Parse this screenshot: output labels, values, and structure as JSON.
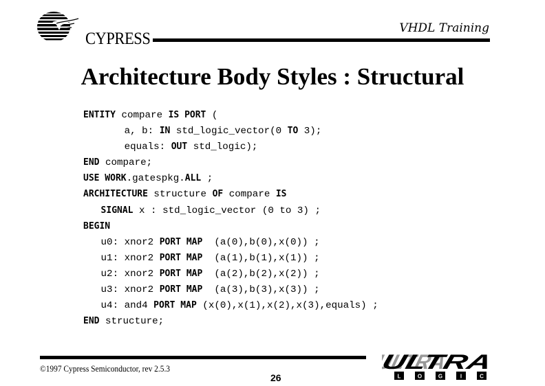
{
  "header": {
    "logo_text": "CYPRESS",
    "course_title": "VHDL Training"
  },
  "slide": {
    "title": "Architecture Body Styles : Structural",
    "code_lines": [
      [
        {
          "t": "ENTITY",
          "k": true
        },
        {
          "t": " compare "
        },
        {
          "t": "IS PORT",
          "k": true
        },
        {
          "t": " ("
        }
      ],
      [
        {
          "t": "       a, b: "
        },
        {
          "t": "IN",
          "k": true
        },
        {
          "t": " std_logic_vector(0 "
        },
        {
          "t": "TO",
          "k": true
        },
        {
          "t": " 3);"
        }
      ],
      [
        {
          "t": "       equals: "
        },
        {
          "t": "OUT",
          "k": true
        },
        {
          "t": " std_logic);"
        }
      ],
      [
        {
          "t": "END",
          "k": true
        },
        {
          "t": " compare;"
        }
      ],
      [
        {
          "t": "USE WORK",
          "k": true
        },
        {
          "t": ".gatespkg."
        },
        {
          "t": "ALL",
          "k": true
        },
        {
          "t": " ;"
        }
      ],
      [
        {
          "t": "ARCHITECTURE",
          "k": true
        },
        {
          "t": " structure "
        },
        {
          "t": "OF",
          "k": true
        },
        {
          "t": " compare "
        },
        {
          "t": "IS",
          "k": true
        }
      ],
      [
        {
          "t": "   "
        },
        {
          "t": "SIGNAL",
          "k": true
        },
        {
          "t": " x : std_logic_vector (0 to 3) ;"
        }
      ],
      [
        {
          "t": "BEGIN",
          "k": true
        }
      ],
      [
        {
          "t": "   u0: xnor2 "
        },
        {
          "t": "PORT MAP",
          "k": true
        },
        {
          "t": "  (a(0),b(0),x(0)) ;"
        }
      ],
      [
        {
          "t": "   u1: xnor2 "
        },
        {
          "t": "PORT MAP",
          "k": true
        },
        {
          "t": "  (a(1),b(1),x(1)) ;"
        }
      ],
      [
        {
          "t": "   u2: xnor2 "
        },
        {
          "t": "PORT MAP",
          "k": true
        },
        {
          "t": "  (a(2),b(2),x(2)) ;"
        }
      ],
      [
        {
          "t": "   u3: xnor2 "
        },
        {
          "t": "PORT MAP",
          "k": true
        },
        {
          "t": "  (a(3),b(3),x(3)) ;"
        }
      ],
      [
        {
          "t": "   u4: and4 "
        },
        {
          "t": "PORT MAP",
          "k": true
        },
        {
          "t": " (x(0),x(1),x(2),x(3),equals) ;"
        }
      ],
      [
        {
          "t": "END",
          "k": true
        },
        {
          "t": " structure;"
        }
      ]
    ]
  },
  "footer": {
    "copyright": "©1997 Cypress Semiconductor, rev 2.5.3",
    "page_number": "26",
    "brand_main": "ULTRA",
    "brand_sub": [
      "L",
      "O",
      "G",
      "I",
      "C"
    ]
  }
}
